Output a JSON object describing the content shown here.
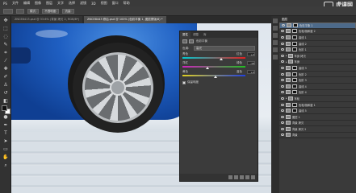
{
  "menubar": {
    "items": [
      "PS",
      "文件",
      "编辑",
      "图像",
      "图层",
      "文字",
      "选择",
      "滤镜",
      "3D",
      "视图",
      "窗口",
      "帮助"
    ]
  },
  "watermark": {
    "text": "虎课网"
  },
  "options": {
    "items": [
      "模式:",
      "不透明度:",
      "流量:"
    ]
  },
  "tabs": [
    {
      "label": "ZNCE8413.psd @ 33.6% (背景 拷贝 2, RGB/8*)",
      "active": false
    },
    {
      "label": "ZNCE8443 修后.psd @ 100% (色彩平衡 1, 图层蒙版/8) *",
      "active": true
    }
  ],
  "properties": {
    "tabs": [
      "属性",
      "调整",
      "库"
    ],
    "title": "色彩平衡",
    "tone_label": "色调:",
    "tone_value": "高光",
    "sliders": [
      {
        "left": "青色",
        "right": "红色",
        "value": "+2",
        "position": 0.62
      },
      {
        "left": "洋红",
        "right": "绿色",
        "value": "-18",
        "position": 0.4
      },
      {
        "left": "黄色",
        "right": "蓝色",
        "value": "+4",
        "position": 0.53
      }
    ],
    "preserve_luminosity": "保留明度"
  },
  "layers": {
    "header": "图层",
    "rows": [
      {
        "name": "色彩平衡 1",
        "type": "adj",
        "selected": true
      },
      {
        "name": "色相/饱和度 2",
        "type": "adj",
        "selected": false
      },
      {
        "name": "曲线 1",
        "type": "adj",
        "selected": false
      },
      {
        "name": "曲线 2",
        "type": "adj",
        "selected": false
      },
      {
        "name": "色阶 1",
        "type": "adj",
        "selected": false
      },
      {
        "name": "车身 拷贝",
        "type": "group",
        "selected": false
      },
      {
        "name": "车身",
        "type": "group",
        "selected": false
      },
      {
        "name": "曲线 3",
        "type": "adj",
        "selected": false
      },
      {
        "name": "色阶 2",
        "type": "adj",
        "selected": false
      },
      {
        "name": "色阶 3",
        "type": "adj",
        "selected": false
      },
      {
        "name": "曲线 4",
        "type": "adj",
        "selected": false
      },
      {
        "name": "色阶 4",
        "type": "adj",
        "selected": false
      },
      {
        "name": "车轮",
        "type": "group",
        "selected": false
      },
      {
        "name": "色相/饱和度 1",
        "type": "adj",
        "selected": false
      },
      {
        "name": "曲线 5",
        "type": "adj",
        "selected": false
      },
      {
        "name": "图层 1",
        "type": "pixel",
        "selected": false
      },
      {
        "name": "背景 拷贝",
        "type": "pixel",
        "selected": false
      },
      {
        "name": "背景 拷贝 2",
        "type": "pixel",
        "selected": false
      },
      {
        "name": "背景",
        "type": "pixel",
        "selected": false
      }
    ]
  },
  "colors": {
    "cyan_red": [
      "#00c8d0",
      "#e02020"
    ],
    "magenta_green": [
      "#d020c0",
      "#20c020"
    ],
    "yellow_blue": [
      "#e0d020",
      "#2040e0"
    ]
  }
}
